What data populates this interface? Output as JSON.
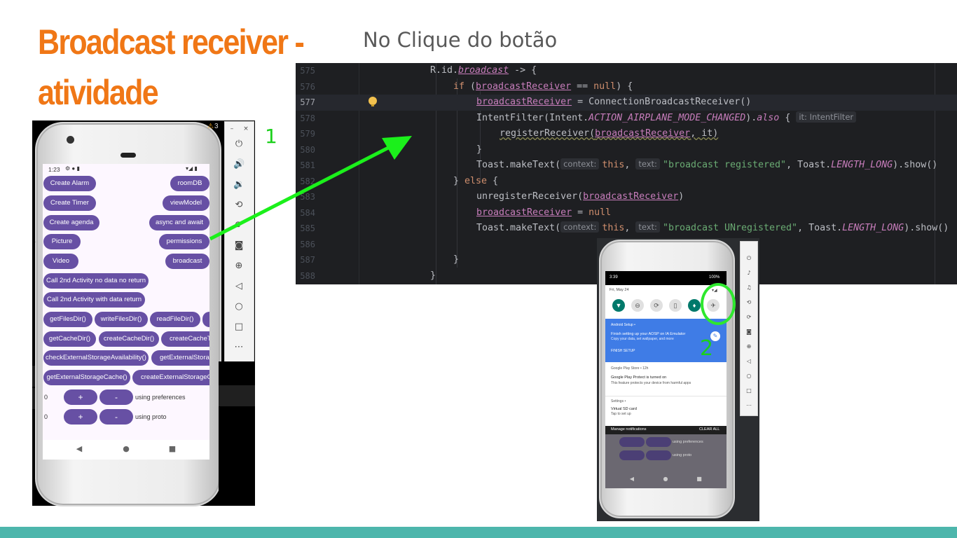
{
  "slide": {
    "title_line1": "Broadcast receiver -",
    "title_line2": "atividade",
    "subtitle": "No Clique do botão",
    "marker_1": "1",
    "marker_2": "2",
    "colors": {
      "title": "#f07716",
      "footer": "#4db6ac",
      "arrow": "#1bf01b",
      "circle": "#2ee82e"
    }
  },
  "editor": {
    "lines": [
      {
        "num": "575",
        "indent": 0
      },
      {
        "num": "576",
        "indent": 1
      },
      {
        "num": "577",
        "indent": 2,
        "current": true
      },
      {
        "num": "578",
        "indent": 2
      },
      {
        "num": "579",
        "indent": 3
      },
      {
        "num": "580",
        "indent": 2
      },
      {
        "num": "581",
        "indent": 2
      },
      {
        "num": "582",
        "indent": 1
      },
      {
        "num": "583",
        "indent": 2
      },
      {
        "num": "584",
        "indent": 2
      },
      {
        "num": "585",
        "indent": 2
      },
      {
        "num": "586",
        "indent": 0
      },
      {
        "num": "587",
        "indent": 1
      },
      {
        "num": "588",
        "indent": 0
      }
    ],
    "code": {
      "l575_a": "R.id.",
      "l575_b": "broadcast",
      "l575_c": " -> {",
      "l576_kw": "if",
      "l576_a": " (",
      "l576_f": "broadcastReceiver",
      "l576_b": " == ",
      "l576_null": "null",
      "l576_c": ") {",
      "l577_f": "broadcastReceiver",
      "l577_a": " = ConnectionBroadcastReceiver()",
      "l578_a": "IntentFilter(Intent.",
      "l578_s": "ACTION_AIRPLANE_MODE_CHANGED",
      "l578_b": ").",
      "l578_also": "also",
      "l578_c": " {",
      "l578_hint": "it: IntentFilter",
      "l579_a": "registerReceiver(",
      "l579_f": "broadcastReceiver",
      "l579_b": ", it)",
      "l580_a": "}",
      "l581_a": "Toast.makeText(",
      "l581_h1": "context:",
      "l581_this": "this",
      "l581_b": ", ",
      "l581_h2": "text:",
      "l581_str": "\"broadcast registered\"",
      "l581_c": ", Toast.",
      "l581_s": "LENGTH_LONG",
      "l581_d": ").show()",
      "l582_a": "} ",
      "l582_kw": "else",
      "l582_b": " {",
      "l583_a": "unregisterReceiver(",
      "l583_f": "broadcastReceiver",
      "l583_b": ")",
      "l584_f": "broadcastReceiver",
      "l584_a": " = ",
      "l584_null": "null",
      "l585_a": "Toast.makeText(",
      "l585_h1": "context:",
      "l585_this": "this",
      "l585_b": ", ",
      "l585_h2": "text:",
      "l585_str": "\"broadcast UNregistered\"",
      "l585_c": ", Toast.",
      "l585_s": "LENGTH_LONG",
      "l585_d": ").show()",
      "l587_a": "}",
      "l588_a": "}"
    }
  },
  "phone1": {
    "status_time": "1:23",
    "emulator_badge": "3",
    "buttons_left": [
      "Create Alarm",
      "Create Timer",
      "Create agenda",
      "Picture",
      "Video",
      "Call 2nd Activity no data no return",
      "Call 2nd Activity with data return"
    ],
    "buttons_right": [
      "roomDB",
      "viewModel",
      "async and await",
      "permissions",
      "broadcast"
    ],
    "row_files": [
      "getFilesDir()",
      "writeFilesDir()",
      "readFileDir()"
    ],
    "row_cache": [
      "getCacheDir()",
      "createCacheDir()",
      "createCacheTm"
    ],
    "row_ext1": [
      "checkExternalStorageAvailability()",
      "getExternalStorage("
    ],
    "row_ext2": [
      "getExternalStorageCache()",
      "createExternalStorageCach"
    ],
    "pref_count": "0",
    "pref_plus": "+",
    "pref_minus": "-",
    "pref_label": "using preferences",
    "proto_count": "0",
    "proto_plus": "+",
    "proto_minus": "-",
    "proto_label": "using proto"
  },
  "phone2": {
    "status_time": "3:39",
    "battery": "100%",
    "date": "Fri, May 24",
    "notif1_app": "Android Setup •",
    "notif1_title": "Finish setting up your AOSP on IA Emulator",
    "notif1_body": "Copy your data, set wallpaper, and more",
    "notif1_action": "FINISH SETUP",
    "notif2_app": "Google Play Store • 12h",
    "notif2_title": "Google Play Protect is turned on",
    "notif2_body": "This feature protects your device from harmful apps",
    "notif3_app": "Settings •",
    "notif3_title": "Virtual SD card",
    "notif3_body": "Tap to set up",
    "manage": "Manage notifications",
    "clear_all": "CLEAR ALL",
    "bg_label1": "using preferences",
    "bg_label2": "using proto"
  }
}
